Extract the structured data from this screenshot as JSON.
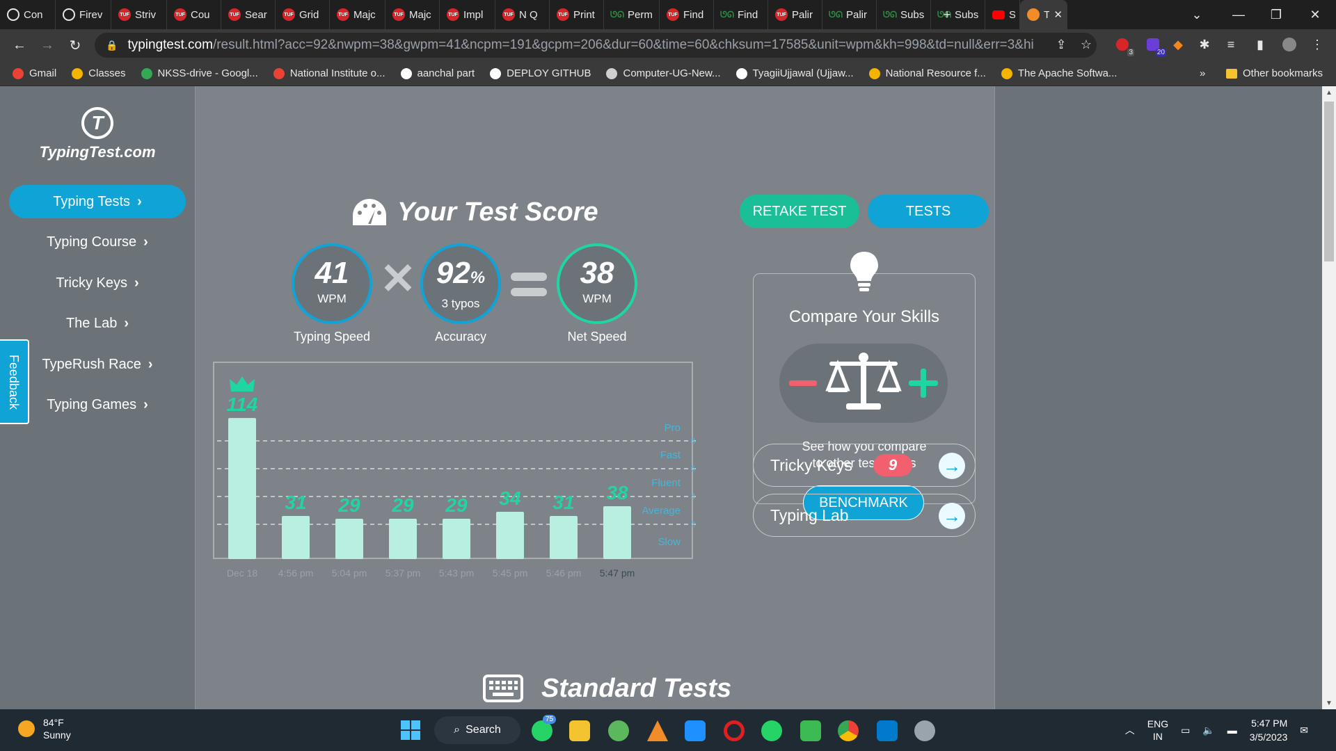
{
  "browser": {
    "tabs": [
      {
        "title": "Con",
        "icon": "globe"
      },
      {
        "title": "Firev",
        "icon": "globe"
      },
      {
        "title": "Striv",
        "icon": "tuf"
      },
      {
        "title": "Cou",
        "icon": "tuf"
      },
      {
        "title": "Sear",
        "icon": "tuf"
      },
      {
        "title": "Grid",
        "icon": "tuf"
      },
      {
        "title": "Majc",
        "icon": "tuf"
      },
      {
        "title": "Majc",
        "icon": "tuf"
      },
      {
        "title": "Impl",
        "icon": "tuf"
      },
      {
        "title": "N Q",
        "icon": "tuf"
      },
      {
        "title": "Print",
        "icon": "tuf"
      },
      {
        "title": "Perm",
        "icon": "gfg"
      },
      {
        "title": "Find",
        "icon": "tuf"
      },
      {
        "title": "Find",
        "icon": "gfg"
      },
      {
        "title": "Palir",
        "icon": "tuf"
      },
      {
        "title": "Palir",
        "icon": "gfg"
      },
      {
        "title": "Subs",
        "icon": "gfg"
      },
      {
        "title": "Subs",
        "icon": "gfg"
      },
      {
        "title": "S",
        "icon": "youtube"
      },
      {
        "title": "T",
        "icon": "typingtest"
      }
    ],
    "fav_tuf_text": "TUF",
    "fav_gfg_text": "ᘎᘏ",
    "url_host": "typingtest.com",
    "url_rest": "/result.html?acc=92&nwpm=38&gwpm=41&ncpm=191&gcpm=206&dur=60&time=60&chksum=17585&unit=wpm&kh=998&td=null&err=3&hits=206...",
    "ext_badge_1": "3",
    "ext_badge_2": "20",
    "bookmarks": [
      {
        "label": "Gmail",
        "color": "#ea4335"
      },
      {
        "label": "Classes",
        "color": "#f4b400"
      },
      {
        "label": "NKSS-drive - Googl...",
        "color": "#34a853"
      },
      {
        "label": "National Institute o...",
        "color": "#ea4335"
      },
      {
        "label": "aanchal part",
        "color": "#ffffff"
      },
      {
        "label": "DEPLOY GITHUB",
        "color": "#ffffff"
      },
      {
        "label": "Computer-UG-New...",
        "color": "#cfcfcf"
      },
      {
        "label": "TyagiiUjjawal (Ujjaw...",
        "color": "#ffffff"
      },
      {
        "label": "National Resource f...",
        "color": "#f4b400"
      },
      {
        "label": "The Apache Softwa...",
        "color": "#f4b400"
      }
    ],
    "bookmarks_more": "»",
    "other_bookmarks": "Other bookmarks"
  },
  "sidebar": {
    "logo_mark": "T",
    "logo_text": "TypingTest.com",
    "items": [
      {
        "label": "Typing Tests"
      },
      {
        "label": "Typing Course"
      },
      {
        "label": "Tricky Keys"
      },
      {
        "label": "The Lab"
      },
      {
        "label": "TypeRush Race"
      },
      {
        "label": "Typing Games"
      }
    ],
    "feedback": "Feedback"
  },
  "score": {
    "title": "Your Test Score",
    "retake": "RETAKE TEST",
    "tests": "TESTS",
    "speed_value": "41",
    "speed_unit": "WPM",
    "speed_label": "Typing Speed",
    "accuracy_value": "92",
    "accuracy_pct": "%",
    "accuracy_sub": "3  typos",
    "accuracy_label": "Accuracy",
    "net_value": "38",
    "net_unit": "WPM",
    "net_label": "Net Speed"
  },
  "chart_data": {
    "type": "bar",
    "categories": [
      "Dec 18",
      "4:56 pm",
      "5:04 pm",
      "5:37 pm",
      "5:43 pm",
      "5:45 pm",
      "5:46 pm",
      "5:47 pm"
    ],
    "values": [
      114,
      31,
      29,
      29,
      29,
      34,
      31,
      38
    ],
    "bands": [
      {
        "label": "Slow",
        "value": 0
      },
      {
        "label": "Average",
        "value": 25
      },
      {
        "label": "Fluent",
        "value": 45
      },
      {
        "label": "Fast",
        "value": 65
      },
      {
        "label": "Pro",
        "value": 85
      }
    ],
    "ylim": [
      0,
      114
    ],
    "bar_color": "#b8efe1",
    "label_color": "#1fd6a1"
  },
  "compare": {
    "title": "Compare Your Skills",
    "text_1": "See how you compare",
    "text_2": "to other test takers",
    "benchmark": "BENCHMARK"
  },
  "links": {
    "tricky_keys": "Tricky Keys",
    "tricky_count": "9",
    "typing_lab": "Typing Lab"
  },
  "standard_tests": "Standard Tests",
  "taskbar": {
    "temp": "84°F",
    "condition": "Sunny",
    "search": "Search",
    "whatsapp_badge": "75",
    "lang_1": "ENG",
    "lang_2": "IN",
    "time": "5:47 PM",
    "date": "3/5/2023"
  }
}
